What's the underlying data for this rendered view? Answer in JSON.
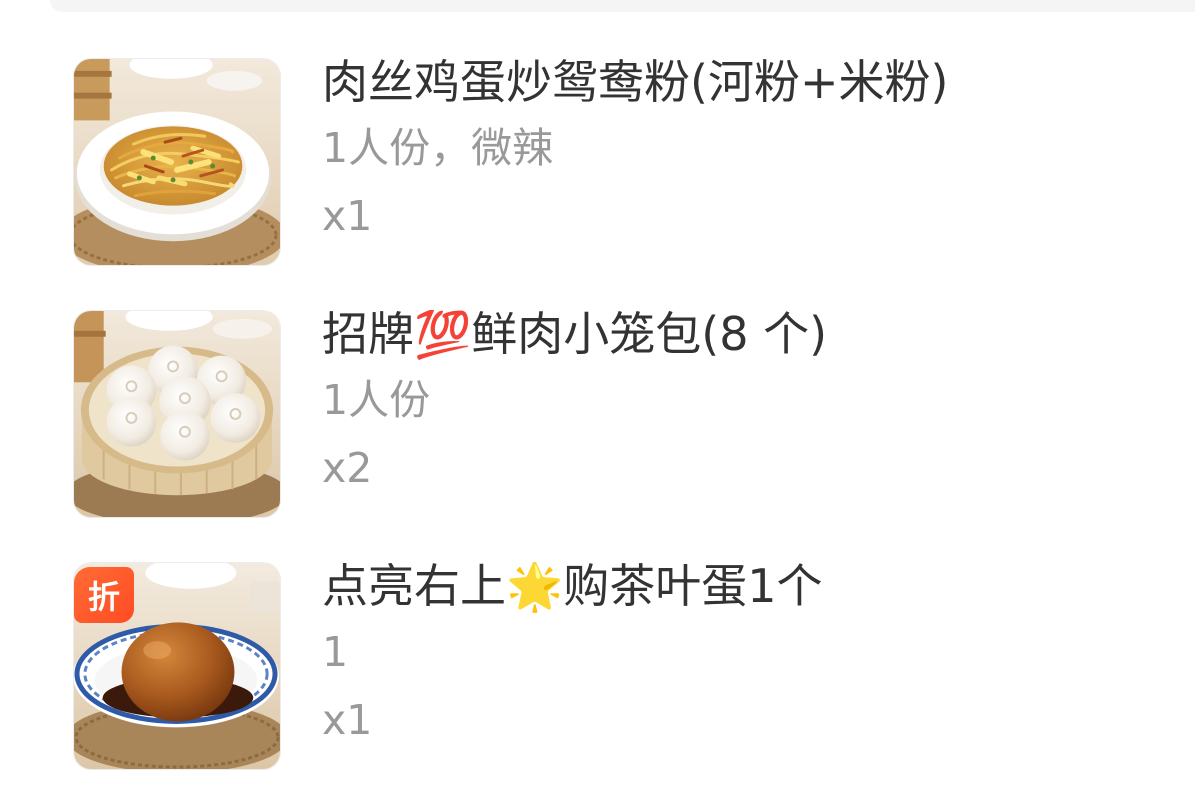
{
  "order_items": [
    {
      "title": "肉丝鸡蛋炒鸳鸯粉(河粉+米粉)",
      "spec": "1人份，微辣",
      "quantity": "x1"
    },
    {
      "title": "招牌💯鲜肉小笼包(8 个)",
      "spec": "1人份",
      "quantity": "x2"
    },
    {
      "title": "点亮右上🌟购茶叶蛋1个",
      "spec": "1",
      "quantity": "x1",
      "badge": "折"
    }
  ],
  "colors": {
    "title_text": "#333333",
    "secondary_text": "#999999",
    "discount_badge": "#ff4b24",
    "page_background": "#ffffff"
  }
}
